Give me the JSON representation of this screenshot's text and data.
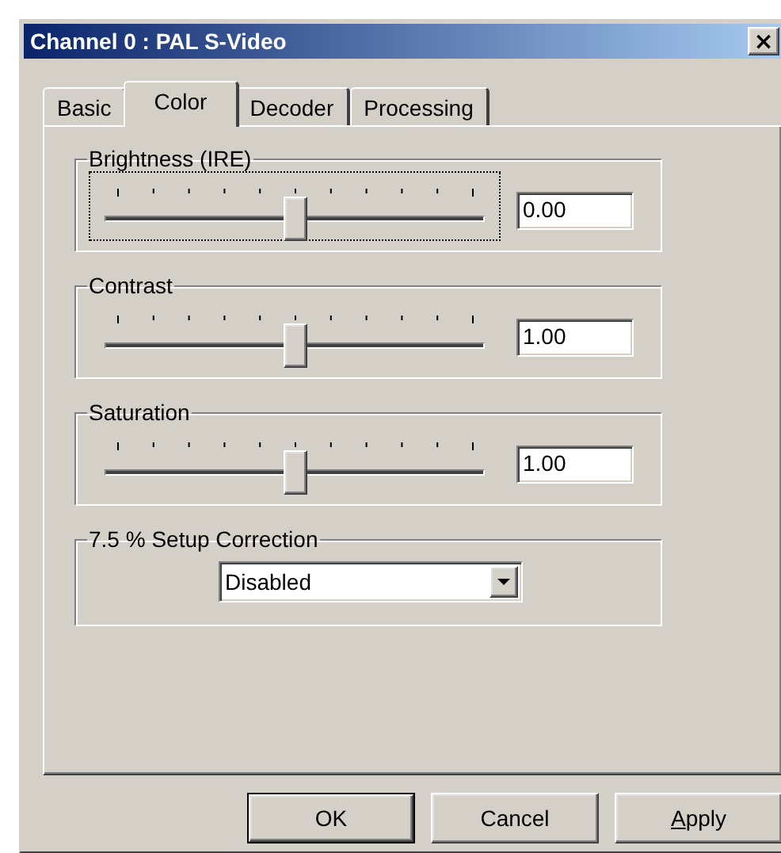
{
  "window": {
    "title": "Channel 0 : PAL S-Video",
    "close": "×"
  },
  "tabs": [
    {
      "label": "Basic",
      "selected": false
    },
    {
      "label": "Color",
      "selected": true
    },
    {
      "label": "Decoder",
      "selected": false
    },
    {
      "label": "Processing",
      "selected": false
    }
  ],
  "groups": [
    {
      "kind": "slider",
      "label": "Brightness (IRE)",
      "level": 0.5,
      "value": "0.00",
      "focused": true
    },
    {
      "kind": "slider",
      "label": "Contrast",
      "level": 0.5,
      "value": "1.00",
      "focused": false
    },
    {
      "kind": "slider",
      "label": "Saturation",
      "level": 0.5,
      "value": "1.00",
      "focused": false
    },
    {
      "kind": "dropdown",
      "label": "7.5 % Setup Correction",
      "value": "Disabled"
    }
  ],
  "buttons": [
    {
      "label": "OK",
      "default": true,
      "mnemonic": false
    },
    {
      "label": "Cancel",
      "default": false,
      "mnemonic": false
    },
    {
      "label": "Apply",
      "default": false,
      "mnemonic": true
    }
  ]
}
